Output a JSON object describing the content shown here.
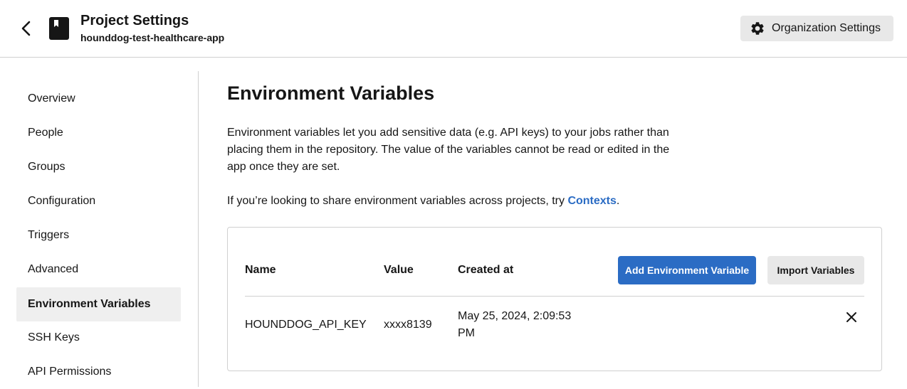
{
  "header": {
    "title": "Project Settings",
    "project_name": "hounddog-test-healthcare-app",
    "org_settings_label": "Organization Settings"
  },
  "sidebar": {
    "items": [
      {
        "label": "Overview",
        "active": false
      },
      {
        "label": "People",
        "active": false
      },
      {
        "label": "Groups",
        "active": false
      },
      {
        "label": "Configuration",
        "active": false
      },
      {
        "label": "Triggers",
        "active": false
      },
      {
        "label": "Advanced",
        "active": false
      },
      {
        "label": "Environment Variables",
        "active": true
      },
      {
        "label": "SSH Keys",
        "active": false
      },
      {
        "label": "API Permissions",
        "active": false
      }
    ]
  },
  "main": {
    "title": "Environment Variables",
    "description": "Environment variables let you add sensitive data (e.g. API keys) to your jobs rather than placing them in the repository. The value of the variables cannot be read or edited in the app once they are set.",
    "share_prefix": "If you’re looking to share environment variables across projects, try ",
    "share_link": "Contexts",
    "share_suffix": "."
  },
  "table": {
    "columns": [
      "Name",
      "Value",
      "Created at"
    ],
    "add_button": "Add Environment Variable",
    "import_button": "Import Variables",
    "rows": [
      {
        "name": "HOUNDDOG_API_KEY",
        "value": "xxxx8139",
        "created_at": "May 25, 2024, 2:09:53 PM"
      }
    ]
  },
  "colors": {
    "accent": "#2b6cc4",
    "active_nav_bg": "#efefef",
    "button_gray": "#e8e8e8"
  },
  "icons": {
    "back": "chevron-left-icon",
    "project": "book-icon",
    "org": "gear-icon",
    "delete": "close-icon"
  }
}
